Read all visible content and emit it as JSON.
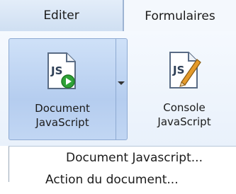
{
  "tabs": [
    {
      "label": "Editer",
      "active": false
    },
    {
      "label": "Formulaires",
      "active": true
    }
  ],
  "ribbon": {
    "document_js": {
      "line1": "Document",
      "line2": "JavaScript",
      "icon": "js-document-icon"
    },
    "console_js": {
      "line1": "Console",
      "line2": "JavaScript",
      "icon": "js-console-icon"
    }
  },
  "menu": {
    "items": [
      {
        "label": "Document Javascript..."
      },
      {
        "label": "Action du document..."
      }
    ]
  },
  "icon_text": "JS",
  "colors": {
    "tab_bg": "#dbe7f5",
    "button_hover": "#b5cdef",
    "js_text": "#2d3e55",
    "play_green": "#2ea236",
    "pencil_orange": "#e49a2a"
  }
}
